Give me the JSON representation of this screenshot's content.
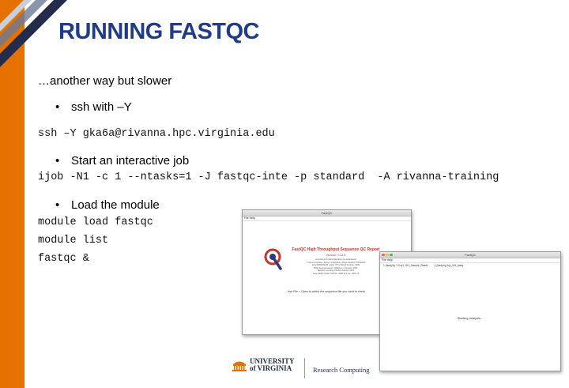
{
  "slide": {
    "title": "RUNNING FASTQC",
    "intro": "…another way but slower",
    "bullet1": "ssh with –Y",
    "cmd_ssh": "ssh –Y gka6a@rivanna.hpc.virginia.edu",
    "bullet2": "Start an interactive job",
    "cmd_ijob": "ijob -N1 -c 1 --ntasks=1 -J fastqc-inte -p standard  -A rivanna-training",
    "bullet3": "Load the module",
    "cmd_module_load": "module load fastqc",
    "cmd_module_list": "module list",
    "cmd_fastqc": "fastqc &"
  },
  "window1": {
    "title": "FastQC",
    "menu": "File  Help",
    "heading": "FastQC High Throughput Sequence QC Report",
    "version": "Version: 0.11.5",
    "credits": [
      "www.bioinformatics.babraham.ac.uk/projects/",
      "© Simon Andrews, Pierre Lindenbaum, Brian Howard, Phil Ewels",
      "Picard BAM/SAM reader ©The Broad Institute, 2009",
      "BZip decompression ©Matthew J. Francis, 2011",
      "Base64 encoding ©Robert Harder, 2012",
      "Java HDF5 reader ©NCSA, 2006 and HL, 2007-14"
    ],
    "hint": "Use File > Open to select the sequence file you want to check"
  },
  "window2": {
    "title": "FastQC",
    "menu": "File  Help",
    "tab1": "1 (fastq.fq) 1.0 fq1_001_Sample_Read1",
    "tab2": "1 (fastq.fq) fq1_001_fastq",
    "status": "Starting analysis..."
  },
  "footer": {
    "uva_line1": "UNIVERSITY",
    "uva_line2": "of VIRGINIA",
    "rc": "Research Computing"
  },
  "colors": {
    "accent_orange": "#e57200",
    "title_blue": "#1f3c88",
    "uva_navy": "#232d4b"
  }
}
